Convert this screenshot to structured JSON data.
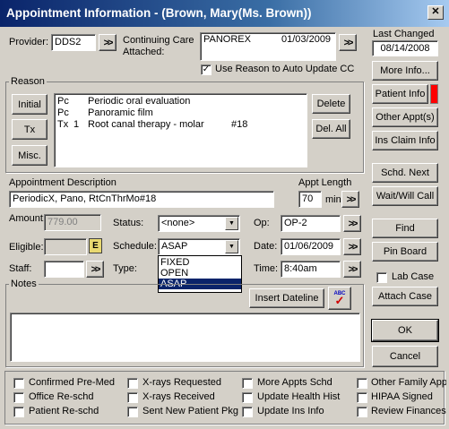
{
  "window": {
    "title": "Appointment Information - (Brown, Mary(Ms. Brown))",
    "close": "✕"
  },
  "provider": {
    "label": "Provider:",
    "value": "DDS2",
    "more": ">>"
  },
  "continuing_care": {
    "label_line1": "Continuing Care",
    "label_line2": "Attached:",
    "item": "PANOREX",
    "date": "01/03/2009",
    "more": ">>"
  },
  "use_reason": {
    "label": "Use Reason to Auto Update CC",
    "checked": true
  },
  "last_changed": {
    "label": "Last Changed",
    "value": "08/14/2008"
  },
  "reason": {
    "title": "Reason",
    "buttons": {
      "initial": "Initial",
      "tx": "Tx",
      "misc": "Misc.",
      "delete": "Delete",
      "del_all": "Del. All"
    },
    "rows": [
      {
        "code": "Pc",
        "num": "",
        "desc": "Periodic oral evaluation",
        "tooth": ""
      },
      {
        "code": "Pc",
        "num": "",
        "desc": "Panoramic film",
        "tooth": ""
      },
      {
        "code": "Tx",
        "num": "1",
        "desc": "Root canal therapy - molar",
        "tooth": "#18"
      }
    ]
  },
  "appt_description": {
    "label": "Appointment Description",
    "value": "PeriodicX, Pano, RtCnThrMo#18"
  },
  "appt_length": {
    "label": "Appt Length",
    "value": "70",
    "unit": "min",
    "more": ">>"
  },
  "amount": {
    "label": "Amount:",
    "value": "779.00"
  },
  "status": {
    "label": "Status:",
    "value": "<none>"
  },
  "op": {
    "label": "Op:",
    "value": "OP-2",
    "more": ">>"
  },
  "eligible": {
    "label": "Eligible:",
    "value": "",
    "e_icon": "E"
  },
  "schedule": {
    "label": "Schedule:",
    "value": "ASAP",
    "options": [
      "FIXED",
      "OPEN",
      "ASAP"
    ],
    "selected_index": 2
  },
  "date": {
    "label": "Date:",
    "value": "01/06/2009",
    "more": ">>"
  },
  "staff": {
    "label": "Staff:",
    "value": "",
    "more": ">>"
  },
  "type": {
    "label": "Type:"
  },
  "time": {
    "label": "Time:",
    "value": "8:40am",
    "more": ">>"
  },
  "notes": {
    "title": "Notes",
    "insert_dateline": "Insert Dateline",
    "spell_icon": "ABC",
    "value": ""
  },
  "side_buttons": {
    "more_info": "More Info...",
    "patient_info": "Patient Info",
    "patient_info_flag_color": "#ff0000",
    "other_appts": "Other Appt(s)",
    "ins_claim_info": "Ins Claim Info",
    "schd_next": "Schd. Next",
    "wait_will_call": "Wait/Will Call",
    "find": "Find",
    "pin_board": "Pin Board",
    "lab_case": "Lab Case",
    "attach_case": "Attach Case",
    "ok": "OK",
    "cancel": "Cancel"
  },
  "checkboxes": [
    {
      "label": "Confirmed Pre-Med",
      "checked": false
    },
    {
      "label": "Office Re-schd",
      "checked": false
    },
    {
      "label": "Patient Re-schd",
      "checked": false
    },
    {
      "label": "X-rays Requested",
      "checked": false
    },
    {
      "label": "X-rays Received",
      "checked": false
    },
    {
      "label": "Sent New Patient Pkg",
      "checked": false
    },
    {
      "label": "More Appts Schd",
      "checked": false
    },
    {
      "label": "Update Health Hist",
      "checked": false
    },
    {
      "label": "Update Ins Info",
      "checked": false
    },
    {
      "label": "Other Family Appt",
      "checked": false
    },
    {
      "label": "HIPAA Signed",
      "checked": false
    },
    {
      "label": "Review Finances",
      "checked": false
    }
  ]
}
